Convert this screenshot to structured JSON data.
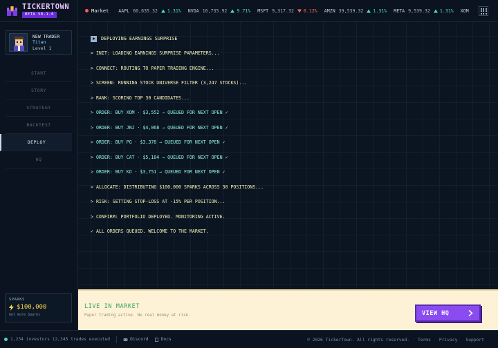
{
  "brand": {
    "name": "TICKERTOWN",
    "badge": "BETA V0.1.0"
  },
  "ticker": {
    "market_label": "Market",
    "items": [
      {
        "symbol": "AAPL",
        "price": "60,635.32",
        "dir": "up",
        "change": "1.31%"
      },
      {
        "symbol": "NVDA",
        "price": "16,735.92",
        "dir": "up",
        "change": "9.71%"
      },
      {
        "symbol": "MSFT",
        "price": "9,317.32",
        "dir": "down",
        "change": "0.12%"
      },
      {
        "symbol": "AMZN",
        "price": "39,539.32",
        "dir": "up",
        "change": "1.31%"
      },
      {
        "symbol": "META",
        "price": "9,539.32",
        "dir": "up",
        "change": "1.31%"
      },
      {
        "symbol": "XOM",
        "price": "",
        "dir": "",
        "change": ""
      }
    ]
  },
  "profile": {
    "title": "NEW TRADER",
    "name": "Titan",
    "level": "Level 1"
  },
  "nav": {
    "items": [
      {
        "label": "START"
      },
      {
        "label": "STORY"
      },
      {
        "label": "STRATEGY"
      },
      {
        "label": "BACKTEST"
      },
      {
        "label": "DEPLOY"
      },
      {
        "label": "HQ"
      }
    ],
    "active": "DEPLOY"
  },
  "sparks": {
    "label": "SPARKS",
    "value": "$100,000",
    "link": "Get more Sparks"
  },
  "log": {
    "header": "DEPLOYING EARNINGS SURPRISE",
    "lines": [
      {
        "text": "> INIT: LOADING EARNINGS SURPRISE PARAMETERS...",
        "kind": "info"
      },
      {
        "text": "> CONNECT: ROUTING TO PAPER TRADING ENGINE...",
        "kind": "info"
      },
      {
        "text": "> SCREEN: RUNNING STOCK UNIVERSE FILTER (3,247 STOCKS)...",
        "kind": "info"
      },
      {
        "text": "> RANK: SCORING TOP 30 CANDIDATES...",
        "kind": "info"
      },
      {
        "text": "> ORDER: BUY XOM · $3,552 → QUEUED FOR NEXT OPEN ✓",
        "kind": "order"
      },
      {
        "text": "> ORDER: BUY JNJ · $4,068 → QUEUED FOR NEXT OPEN ✓",
        "kind": "order"
      },
      {
        "text": "> ORDER: BUY PG · $3,378 → QUEUED FOR NEXT OPEN ✓",
        "kind": "order"
      },
      {
        "text": "> ORDER: BUY CAT · $5,184 → QUEUED FOR NEXT OPEN ✓",
        "kind": "order"
      },
      {
        "text": "> ORDER: BUY KO · $3,751 → QUEUED FOR NEXT OPEN ✓",
        "kind": "order"
      },
      {
        "text": "> ALLOCATE: DISTRIBUTING $100,000 SPARKS ACROSS 30 POSITIONS...",
        "kind": "info"
      },
      {
        "text": "> RISK: SETTING STOP-LOSS AT -15% PER POSITION...",
        "kind": "info"
      },
      {
        "text": "> CONFIRM: PORTFOLIO DEPLOYED. MONITORING ACTIVE.",
        "kind": "info"
      },
      {
        "text": "✓ ALL ORDERS QUEUED. WELCOME TO THE MARKET.",
        "kind": "final"
      }
    ]
  },
  "live": {
    "title": "LIVE IN MARKET",
    "subtitle": "Paper trading active. No real money at risk.",
    "button": "VIEW HQ"
  },
  "footer": {
    "stats": "1,234 investors 12,345 trades executed",
    "discord": "Discord",
    "docs": "Docs",
    "copyright": "© 2026 TickerTown. All rights reserved.",
    "terms": "Terms",
    "privacy": "Privacy",
    "support": "Support"
  },
  "colors": {
    "background": "#0b1522",
    "accent": "#8a4cf0",
    "up": "#4dd8c6",
    "down": "#ff6b6b",
    "log_text": "#f6f0b5",
    "order_text": "#8ff0dd",
    "live_green": "#3aa55a",
    "sparks_gold": "#ffd84d"
  }
}
